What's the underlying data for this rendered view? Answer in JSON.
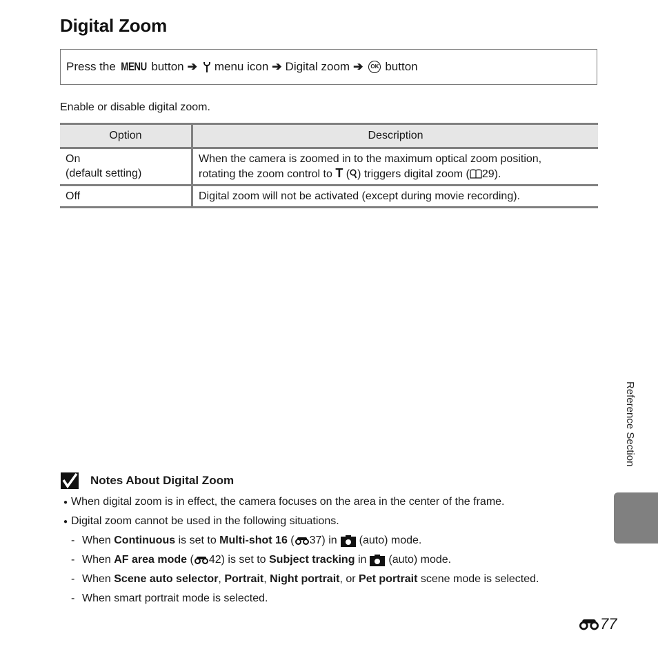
{
  "page": {
    "title": "Digital Zoom",
    "procedure": {
      "press_the": "Press the",
      "menu_button": "MENU",
      "button_word": "button",
      "menu_icon_text": "menu icon",
      "item": "Digital zoom",
      "ok_label": "OK",
      "final_button": "button",
      "icons": [
        "arrow-right-icon",
        "wrench-setup-icon",
        "ok-button-icon"
      ]
    },
    "intro": "Enable or disable digital zoom.",
    "table": {
      "headers": [
        "Option",
        "Description"
      ],
      "rows": [
        {
          "option_line1": "On",
          "option_line2": "(default setting)",
          "desc_line1": "When the camera is zoomed in to the maximum optical zoom position,",
          "desc_line2_pre": "rotating the zoom control to",
          "desc_T": "T",
          "desc_q_open": "(",
          "desc_q_close": ") triggers digital zoom (",
          "desc_page": "29)."
        },
        {
          "option_line1": "Off",
          "desc_line1": "Digital zoom will not be activated (except during movie recording)."
        }
      ]
    },
    "notes": {
      "heading": "Notes About Digital Zoom",
      "bullets": [
        "When digital zoom is in effect, the camera focuses on the area in the center of the frame.",
        "Digital zoom cannot be used in the following situations."
      ],
      "sub": {
        "s1": {
          "when": "When",
          "b1": "Continuous",
          "t1": "is set to",
          "b2": "Multi-shot 16",
          "open": "(",
          "ref": "37) in",
          "tail": "(auto) mode."
        },
        "s2": {
          "when": "When",
          "b1": "AF area mode",
          "open": "(",
          "ref": "42) is set to",
          "b2": "Subject tracking",
          "t2": "in",
          "tail": "(auto) mode."
        },
        "s3": {
          "when": "When",
          "b1": "Scene auto selector",
          "c1": ",",
          "b2": "Portrait",
          "c2": ",",
          "b3": "Night portrait",
          "c3": ", or",
          "b4": "Pet portrait",
          "tail": "scene mode is selected."
        },
        "s4": "When smart portrait mode is selected."
      }
    },
    "side_tab_label": "Reference Section",
    "page_number": "77"
  }
}
